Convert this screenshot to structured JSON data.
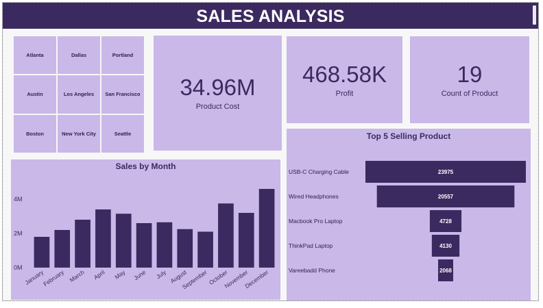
{
  "header": {
    "title": "SALES ANALYSIS"
  },
  "slicer": {
    "cities": [
      "Atlanta",
      "Dallas",
      "Portland",
      "Austin",
      "Los Angeles",
      "San Francisco",
      "Boston",
      "New York City",
      "Seattle"
    ]
  },
  "kpis": {
    "product_cost": {
      "value": "34.96M",
      "label": "Product Cost"
    },
    "profit": {
      "value": "468.58K",
      "label": "Profit"
    },
    "count": {
      "value": "19",
      "label": "Count of Product"
    }
  },
  "colors": {
    "bar": "#3b2a60",
    "panel": "#c9b8e8",
    "header": "#3b2a60"
  },
  "chart_data": [
    {
      "type": "bar",
      "title": "Sales by Month",
      "categories": [
        "January",
        "February",
        "March",
        "April",
        "May",
        "June",
        "July",
        "August",
        "September",
        "October",
        "November",
        "December"
      ],
      "values": [
        1.8,
        2.2,
        2.8,
        3.4,
        3.15,
        2.6,
        2.65,
        2.25,
        2.1,
        3.75,
        3.2,
        4.6
      ],
      "y_ticks": [
        "0M",
        "2M",
        "4M"
      ],
      "ylim": [
        0,
        5.2
      ],
      "grid": false
    },
    {
      "type": "bar",
      "title": "Top 5 Selling Product",
      "categories": [
        "USB-C Charging Cable",
        "Wired Headphones",
        "Macbook Pro Laptop",
        "ThinkPad Laptop",
        "Vareebadd Phone"
      ],
      "values": [
        23975,
        20557,
        4728,
        4130,
        2068
      ],
      "orientation": "horizontal-funnel"
    }
  ]
}
